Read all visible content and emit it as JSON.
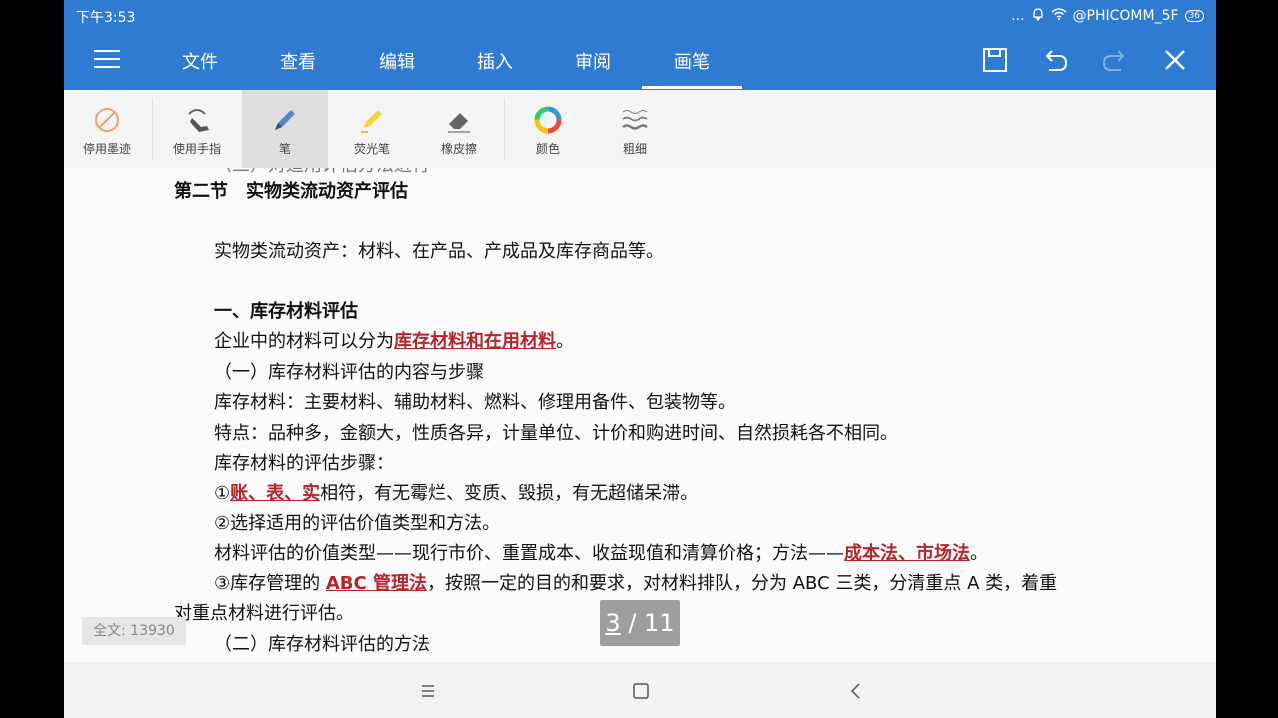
{
  "status": {
    "time": "下午3:53",
    "dots": "...",
    "network": "@PHICOMM_5F",
    "battery": "36"
  },
  "appbar": {
    "tabs": [
      {
        "label": "文件"
      },
      {
        "label": "查看"
      },
      {
        "label": "编辑"
      },
      {
        "label": "插入"
      },
      {
        "label": "审阅"
      },
      {
        "label": "画笔"
      }
    ],
    "active_tab": "画笔"
  },
  "toolbar": {
    "tools": [
      {
        "label": "停用墨迹",
        "icon": "disable-ink-icon"
      },
      {
        "label": "使用手指",
        "icon": "finger-icon"
      },
      {
        "label": "笔",
        "icon": "pen-icon"
      },
      {
        "label": "荧光笔",
        "icon": "highlighter-icon"
      },
      {
        "label": "橡皮擦",
        "icon": "eraser-icon"
      },
      {
        "label": "颜色",
        "icon": "color-wheel-icon"
      },
      {
        "label": "粗细",
        "icon": "thickness-icon"
      }
    ],
    "selected": "笔"
  },
  "document": {
    "cut_line": "（三）对适用评估方法进行",
    "section_title": "第二节　实物类流动资产评估",
    "p_intro": "实物类流动资产：材料、在产品、产成品及库存商品等。",
    "h1": "一、库存材料评估",
    "p1_a": "企业中的材料可以分为",
    "p1_red": "库存材料和在用材料",
    "p1_b": "。",
    "h2": "（一）库存材料评估的内容与步骤",
    "p2": "库存材料：主要材料、辅助材料、燃料、修理用备件、包装物等。",
    "p3": "特点：品种多，金额大，性质各异，计量单位、计价和购进时间、自然损耗各不相同。",
    "p4": "库存材料的评估步骤：",
    "p5_a": "①",
    "p5_red": "账、表、实",
    "p5_b": "相符，有无霉烂、变质、毁损，有无超储呆滞。",
    "p6": "②选择适用的评估价值类型和方法。",
    "p7_a": "材料评估的价值类型——现行市价、重置成本、收益现值和清算价格；方法——",
    "p7_red": "成本法、市场法",
    "p7_b": "。",
    "p8_a": "③库存管理的 ",
    "p8_red": "ABC 管理法",
    "p8_b": "，按照一定的目的和要求，对材料排队，分为 ABC 三类，分清重点 A 类，着重",
    "p9": "对重点材料进行评估。",
    "h3": "（二）库存材料评估的方法"
  },
  "footer": {
    "wordcount": "全文: 13930",
    "page_current": "3",
    "page_sep": " / ",
    "page_total": "11"
  }
}
